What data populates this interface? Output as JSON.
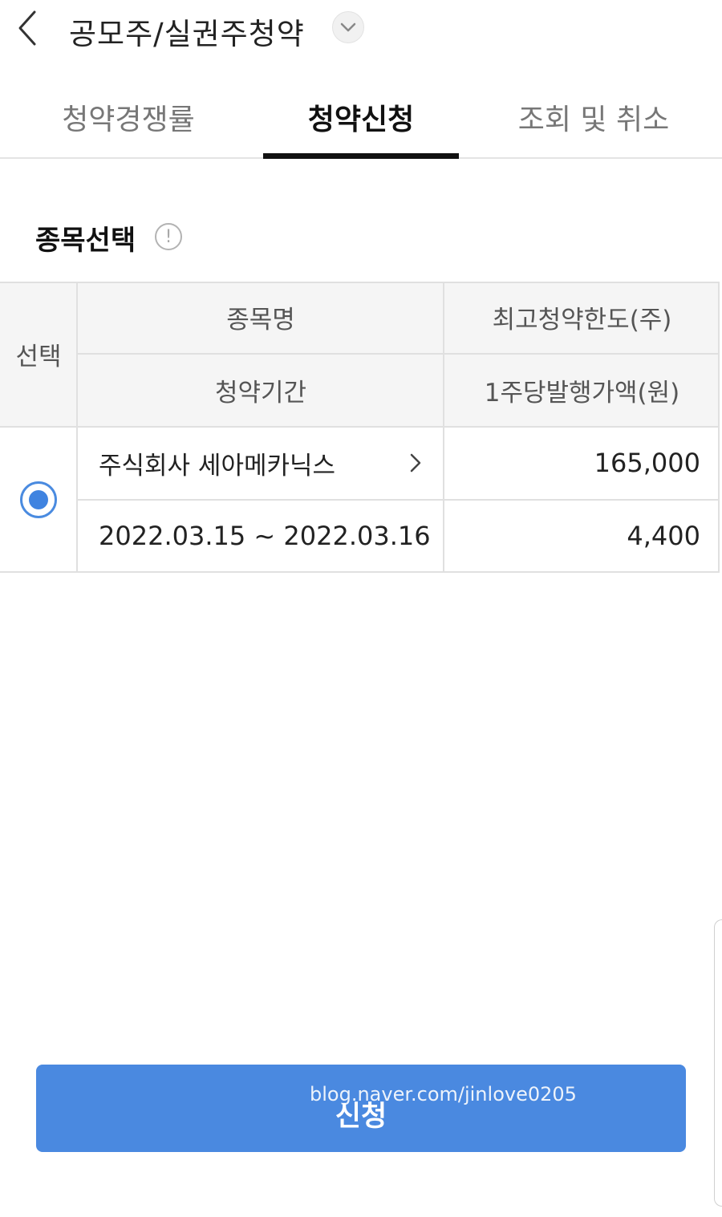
{
  "header": {
    "title": "공모주/실권주청약",
    "back_icon": "chevron-left-icon",
    "dropdown_icon": "chevron-down-icon"
  },
  "tabs": [
    {
      "label": "청약경쟁률",
      "active": false
    },
    {
      "label": "청약신청",
      "active": true
    },
    {
      "label": "조회 및 취소",
      "active": false
    }
  ],
  "section": {
    "title": "종목선택",
    "info_icon": "exclamation-circle-icon",
    "info_glyph": "!"
  },
  "table": {
    "headers": {
      "select": "선택",
      "stock_name": "종목명",
      "max_limit": "최고청약한도(주)",
      "period": "청약기간",
      "price_per_share": "1주당발행가액(원)"
    },
    "rows": [
      {
        "selected": true,
        "stock_name": "주식회사 세아메카닉스",
        "max_limit": "165,000",
        "period": "2022.03.15 ~ 2022.03.16",
        "price_per_share": "4,400"
      }
    ]
  },
  "apply_button": {
    "label": "신청"
  },
  "watermark": "blog.naver.com/jinlove0205",
  "colors": {
    "accent": "#4a89e0",
    "tab_active": "#111111",
    "header_bg": "#f5f5f5"
  }
}
